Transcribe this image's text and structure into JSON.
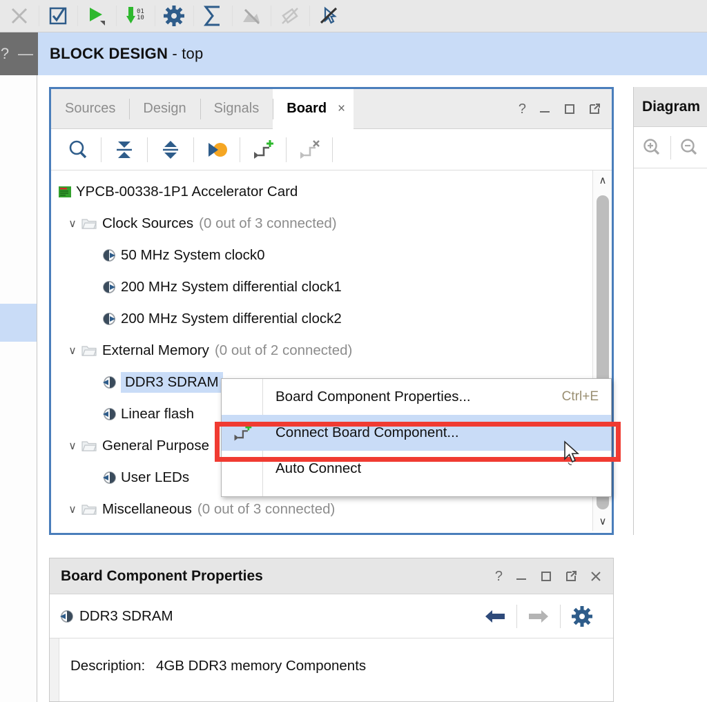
{
  "app_toolbar": {
    "buttons": [
      {
        "name": "close-icon",
        "label": "Close",
        "enabled": false
      },
      {
        "name": "validate-design-icon",
        "label": "Validate Design",
        "enabled": true
      },
      {
        "name": "run-icon",
        "label": "Run",
        "enabled": true
      },
      {
        "name": "generate-output-icon",
        "label": "Generate Output Products",
        "enabled": true
      },
      {
        "name": "settings-gear-icon",
        "label": "Settings",
        "enabled": true
      },
      {
        "name": "sum-sigma-icon",
        "label": "Report",
        "enabled": true
      },
      {
        "name": "no-layout-icon",
        "label": "Regenerate Layout",
        "enabled": false
      },
      {
        "name": "unlink-icon",
        "label": "Unlink",
        "enabled": false
      },
      {
        "name": "no-select-icon",
        "label": "Disable Selection",
        "enabled": true
      }
    ]
  },
  "subheader": {
    "help_glyph": "?",
    "minimize_glyph": "—",
    "title": "BLOCK DESIGN",
    "subtitle": " - top"
  },
  "board_panel": {
    "tabs": [
      {
        "label": "Sources",
        "active": false
      },
      {
        "label": "Design",
        "active": false
      },
      {
        "label": "Signals",
        "active": false
      },
      {
        "label": "Board",
        "active": true
      }
    ],
    "tab_close_glyph": "×",
    "window_controls": [
      {
        "name": "help-icon",
        "glyph": "?"
      },
      {
        "name": "minimize-icon",
        "glyph": "–"
      },
      {
        "name": "maximize-icon",
        "glyph": "□"
      },
      {
        "name": "float-icon",
        "glyph": "↗"
      }
    ],
    "toolbar": [
      {
        "name": "search-icon",
        "label": "Search",
        "enabled": true
      },
      {
        "name": "collapse-all-icon",
        "label": "Collapse All",
        "enabled": true
      },
      {
        "name": "expand-all-icon",
        "label": "Expand All",
        "enabled": true
      },
      {
        "name": "show-connections-icon",
        "label": "Show Connections",
        "enabled": true
      },
      {
        "name": "connect-board-component-icon",
        "label": "Connect Board Component",
        "enabled": true
      },
      {
        "name": "disconnect-board-component-icon",
        "label": "Disconnect Board Component",
        "enabled": false
      }
    ],
    "tree": [
      {
        "level": 0,
        "icon": "board-card-icon",
        "label": "YPCB-00338-1P1 Accelerator Card",
        "note": "",
        "twisty": "",
        "selected": false
      },
      {
        "level": 1,
        "icon": "folder-icon",
        "label": "Clock Sources",
        "note": "(0 out of 3 connected)",
        "twisty": "∨",
        "selected": false
      },
      {
        "level": 2,
        "icon": "component-icon",
        "label": "50 MHz System clock0",
        "note": "",
        "twisty": "",
        "selected": false
      },
      {
        "level": 2,
        "icon": "component-icon",
        "label": "200 MHz System differential clock1",
        "note": "",
        "twisty": "",
        "selected": false
      },
      {
        "level": 2,
        "icon": "component-icon",
        "label": "200 MHz System differential clock2",
        "note": "",
        "twisty": "",
        "selected": false
      },
      {
        "level": 1,
        "icon": "folder-icon",
        "label": "External Memory",
        "note": "(0 out of 2 connected)",
        "twisty": "∨",
        "selected": false
      },
      {
        "level": 2,
        "icon": "component-icon",
        "label": "DDR3 SDRAM",
        "note": "",
        "twisty": "",
        "selected": true
      },
      {
        "level": 2,
        "icon": "component-icon",
        "label": "Linear flash",
        "note": "",
        "twisty": "",
        "selected": false
      },
      {
        "level": 1,
        "icon": "folder-icon",
        "label": "General Purpose",
        "note": "",
        "twisty": "∨",
        "selected": false
      },
      {
        "level": 2,
        "icon": "component-icon",
        "label": "User LEDs",
        "note": "",
        "twisty": "",
        "selected": false
      },
      {
        "level": 1,
        "icon": "folder-icon",
        "label": "Miscellaneous",
        "note": "(0 out of 3 connected)",
        "twisty": "∨",
        "selected": false
      }
    ],
    "scrollbar": {
      "up_glyph": "∧",
      "down_glyph": "∨"
    }
  },
  "context_menu": {
    "items": [
      {
        "label": "Board Component Properties...",
        "accel": "Ctrl+E",
        "icon": "",
        "highlighted": false
      },
      {
        "label": "Connect Board Component...",
        "accel": "",
        "icon": "connect-board-component-icon",
        "highlighted": true
      },
      {
        "label": "Auto Connect",
        "accel": "",
        "icon": "",
        "highlighted": false
      }
    ]
  },
  "diagram_panel": {
    "title": "Diagram",
    "toolbar": [
      {
        "name": "zoom-in-icon",
        "label": "Zoom In"
      },
      {
        "name": "zoom-out-icon",
        "label": "Zoom Out"
      }
    ]
  },
  "properties_panel": {
    "title": "Board Component Properties",
    "window_controls": [
      {
        "name": "help-icon",
        "glyph": "?"
      },
      {
        "name": "minimize-icon",
        "glyph": "–"
      },
      {
        "name": "maximize-icon",
        "glyph": "□"
      },
      {
        "name": "float-icon",
        "glyph": "↗"
      },
      {
        "name": "close-icon",
        "glyph": "×"
      }
    ],
    "component_name": "DDR3 SDRAM",
    "nav": [
      {
        "name": "back-arrow-icon",
        "label": "Back",
        "enabled": true
      },
      {
        "name": "forward-arrow-icon",
        "label": "Forward",
        "enabled": false
      },
      {
        "name": "settings-gear-icon",
        "label": "Settings",
        "enabled": true
      }
    ],
    "description_label": "Description:",
    "description_value": "4GB DDR3 memory Components"
  },
  "colors": {
    "accent_blue": "#4a7ebb",
    "selection_blue": "#c9dcf7",
    "highlight_red": "#f03b32",
    "icon_navy": "#2e5c8a",
    "icon_green": "#2eb82e",
    "toolbar_bg": "#e8e8e8"
  }
}
